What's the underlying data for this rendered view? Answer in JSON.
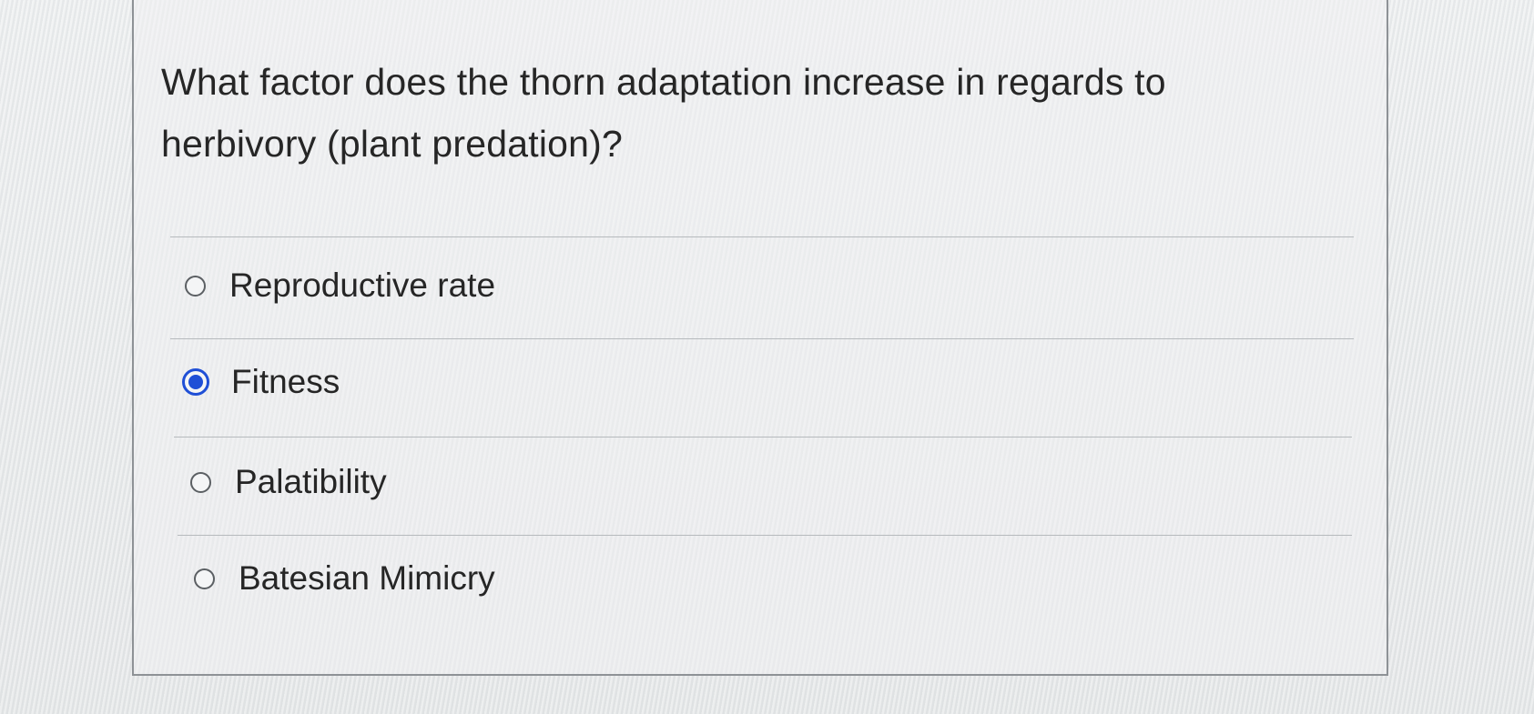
{
  "question": {
    "text": "What factor does the thorn adaptation increase in regards to herbivory (plant predation)?"
  },
  "options": [
    {
      "label": "Reproductive rate",
      "selected": false
    },
    {
      "label": "Fitness",
      "selected": true
    },
    {
      "label": "Palatibility",
      "selected": false
    },
    {
      "label": "Batesian Mimicry",
      "selected": false
    }
  ],
  "colors": {
    "selected_radio": "#1f4fd6",
    "text": "#262626",
    "border": "#8e9296"
  }
}
